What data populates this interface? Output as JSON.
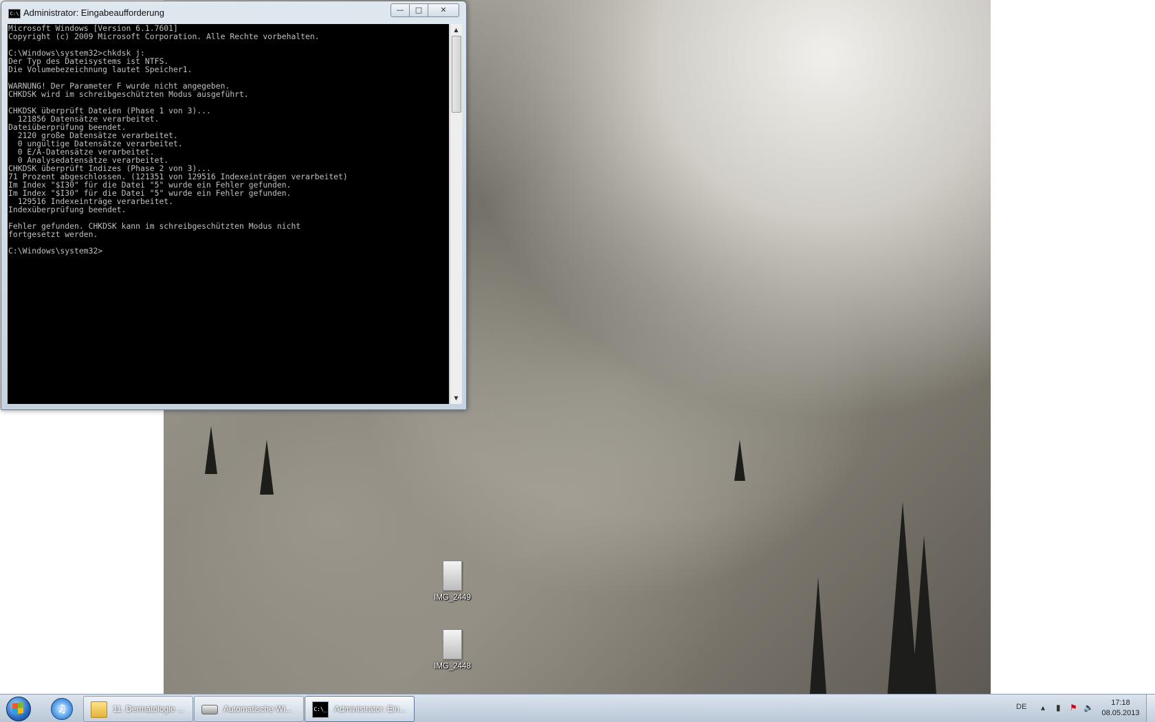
{
  "window": {
    "title": "Administrator: Eingabeaufforderung",
    "icon": "cmd-icon",
    "icon_text": "C:\\",
    "buttons": {
      "minimize": "—",
      "maximize": "□",
      "close": "✕"
    },
    "console_lines": [
      "Microsoft Windows [Version 6.1.7601]",
      "Copyright (c) 2009 Microsoft Corporation. Alle Rechte vorbehalten.",
      "",
      "C:\\Windows\\system32>chkdsk j:",
      "Der Typ des Dateisystems ist NTFS.",
      "Die Volumebezeichnung lautet Speicher1.",
      "",
      "WARNUNG! Der Parameter F wurde nicht angegeben.",
      "CHKDSK wird im schreibgeschützten Modus ausgeführt.",
      "",
      "CHKDSK überprüft Dateien (Phase 1 von 3)...",
      "  121856 Datensätze verarbeitet.",
      "Dateiüberprüfung beendet.",
      "  2120 große Datensätze verarbeitet.",
      "  0 ungültige Datensätze verarbeitet.",
      "  0 E/A-Datensätze verarbeitet.",
      "  0 Analysedatensätze verarbeitet.",
      "CHKDSK überprüft Indizes (Phase 2 von 3)...",
      "71 Prozent abgeschlossen. (121351 von 129516 Indexeinträgen verarbeitet)",
      "Im Index \"$I30\" für die Datei \"5\" wurde ein Fehler gefunden.",
      "Im Index \"$I30\" für die Datei \"5\" wurde ein Fehler gefunden.",
      "  129516 Indexeinträge verarbeitet.",
      "Indexüberprüfung beendet.",
      "",
      "Fehler gefunden. CHKDSK kann im schreibgeschützten Modus nicht",
      "fortgesetzt werden.",
      "",
      "C:\\Windows\\system32>"
    ],
    "scroll": {
      "up": "▲",
      "down": "▼"
    }
  },
  "desktop": {
    "icons": [
      {
        "label": "IMG_2449",
        "icon": "image-file-icon"
      },
      {
        "label": "IMG_2448",
        "icon": "image-file-icon"
      }
    ]
  },
  "taskbar": {
    "start_icon": "windows-logo-icon",
    "pinned": [
      {
        "icon": "itunes-icon",
        "glyph": "♫"
      }
    ],
    "buttons": [
      {
        "label": "11. Dermatologie ...",
        "icon": "folder-icon"
      },
      {
        "label": "Automatische Wi...",
        "icon": "drive-icon"
      },
      {
        "label": "Administrator: Ein...",
        "icon": "cmd-icon",
        "icon_text": "C:\\_"
      }
    ],
    "tray": {
      "language": "DE",
      "icons": [
        "show-hidden-icons-arrow",
        "network-icon",
        "action-center-icon",
        "volume-icon"
      ],
      "glyphs": {
        "arrow": "▴",
        "network": "▮",
        "flag": "⚑",
        "volume": "🔈"
      }
    },
    "clock": {
      "time": "17:18",
      "date": "08.05.2013"
    }
  }
}
